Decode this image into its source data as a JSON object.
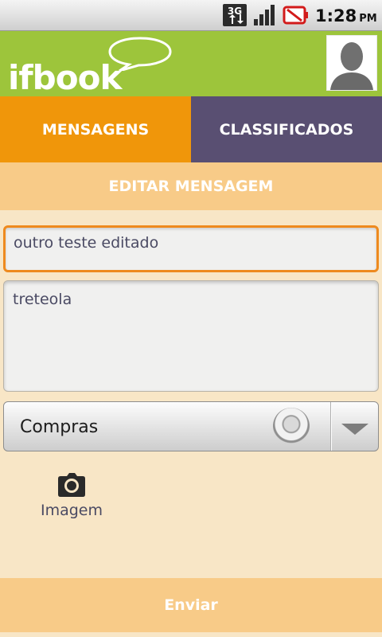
{
  "status_bar": {
    "network": "3G",
    "time": "1:28",
    "ampm": "PM"
  },
  "header": {
    "logo_text": "ifbook"
  },
  "tabs": [
    {
      "label": "MENSAGENS",
      "active": true
    },
    {
      "label": "CLASSIFICADOS",
      "active": false
    }
  ],
  "section": {
    "title": "EDITAR MENSAGEM"
  },
  "form": {
    "title_value": "outro teste editado",
    "body_value": "treteola",
    "category_selected": "Compras",
    "image_label": "Imagem",
    "send_label": "Enviar"
  },
  "colors": {
    "header_green": "#9dc53b",
    "tab_active_orange": "#f0960a",
    "tab_inactive_purple": "#594f72",
    "section_bar": "#f8cb88",
    "background": "#f8e6c6",
    "focus_border": "#ee8a1e"
  },
  "icons": [
    "3g-data-icon",
    "signal-strength-icon",
    "battery-alert-icon",
    "camera-icon",
    "speech-bubble-icon",
    "chevron-down-icon"
  ]
}
